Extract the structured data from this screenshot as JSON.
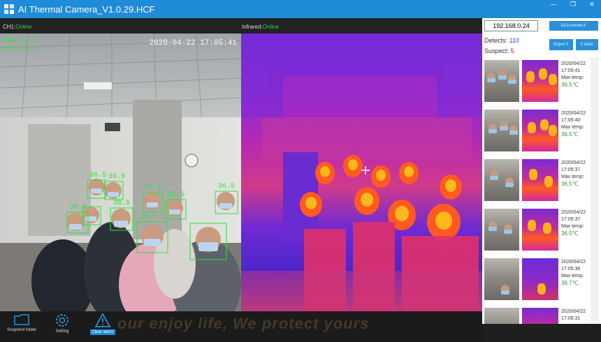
{
  "window": {
    "title": "AI Thermal Camera_V1.0.29.HCF"
  },
  "channels": {
    "ch1_label": "CH1:",
    "ch1_status": "Online",
    "ir_label": "Infrared:",
    "ir_status": "Online"
  },
  "video": {
    "timestamp": "2020-04-22  17:05:41",
    "overlay_line1": "Max:36.6",
    "overlay_line2": "Min:25.6",
    "face_temps": [
      "36.5",
      "36.5",
      "36.5",
      "36.5",
      "36.5",
      "36.6",
      "36.5",
      "36.5"
    ]
  },
  "toolbar": {
    "snapshot_label": "Snapshot folder",
    "setting_label": "Setting",
    "clear_alarm_label": "Clear alarm",
    "slogan": "our enjoy life, We protect yours"
  },
  "panel": {
    "ip": "192.168.0.24",
    "disconnect": "Disconnect",
    "export": "Export",
    "clean": "Clean",
    "detects_label": "Detects:",
    "detects_value": "110",
    "suspect_label": "Suspect:",
    "suspect_value": "5"
  },
  "records": [
    {
      "date": "2020/04/22",
      "time": "17:05:41",
      "label": "Max temp:",
      "temp": "36.5℃"
    },
    {
      "date": "2020/04/22",
      "time": "17:05:40",
      "label": "Max temp:",
      "temp": "36.5℃"
    },
    {
      "date": "2020/04/22",
      "time": "17:05:37",
      "label": "Max temp:",
      "temp": "36.5℃"
    },
    {
      "date": "2020/04/22",
      "time": "17:05:37",
      "label": "Max temp:",
      "temp": "36.5℃"
    },
    {
      "date": "2020/04/22",
      "time": "17:05:36",
      "label": "Max temp:",
      "temp": "36.7℃"
    },
    {
      "date": "2020/04/22",
      "time": "17:05:31",
      "label": "",
      "temp": ""
    }
  ]
}
